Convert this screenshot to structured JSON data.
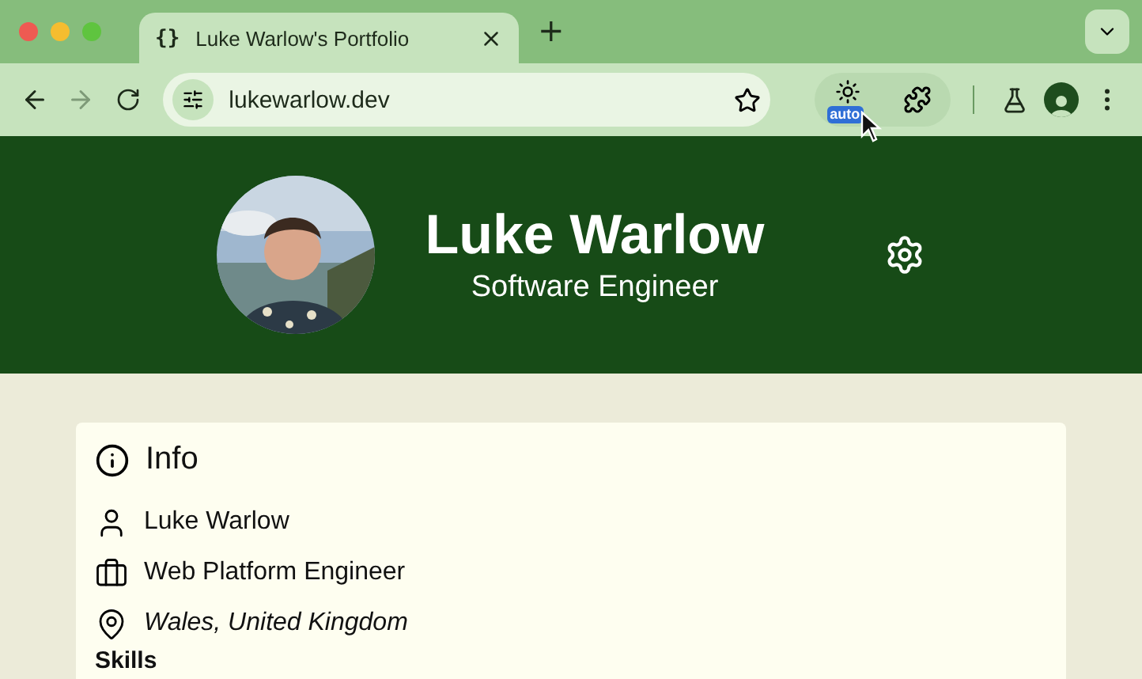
{
  "browser": {
    "tabs": [
      {
        "title": "Luke Warlow's Portfolio",
        "icon": "{}",
        "selected": true
      }
    ],
    "new_tab": "+",
    "address": "lukewarlow.dev",
    "extension_badge": "auto",
    "back_disabled": false,
    "forward_disabled": true
  },
  "header": {
    "name": "Luke Warlow",
    "role": "Software Engineer"
  },
  "info": {
    "title": "Info",
    "items": [
      {
        "kind": "person",
        "text": "Luke Warlow",
        "italic": false
      },
      {
        "kind": "briefcase",
        "text": "Web Platform Engineer",
        "italic": false
      },
      {
        "kind": "location",
        "text": "Wales, United Kingdom",
        "italic": true
      }
    ]
  },
  "next_section": "Skills"
}
